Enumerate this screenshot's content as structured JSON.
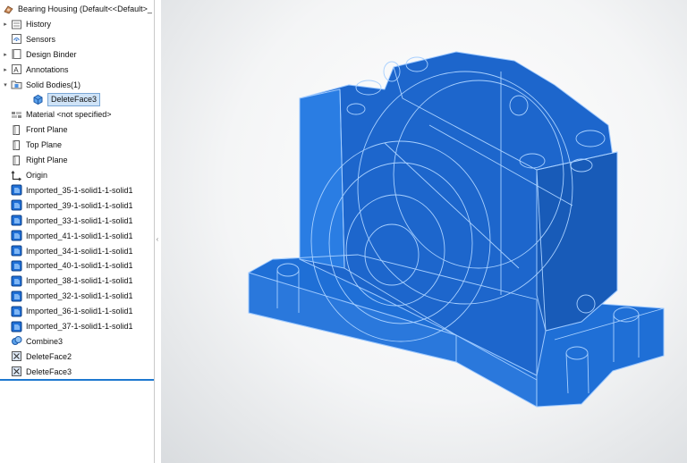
{
  "tree": {
    "root": {
      "label": "Bearing Housing  (Default<<Default>_",
      "icon": "part-icon"
    },
    "items": [
      {
        "label": "History",
        "icon": "history-icon",
        "expand": true
      },
      {
        "label": "Sensors",
        "icon": "sensors-icon",
        "expand": false
      },
      {
        "label": "Design Binder",
        "icon": "design-binder-icon",
        "expand": true
      },
      {
        "label": "Annotations",
        "icon": "annotations-icon",
        "expand": true
      },
      {
        "label": "Solid Bodies(1)",
        "icon": "solid-bodies-folder-icon",
        "expand": "open"
      },
      {
        "label": "DeleteFace3",
        "icon": "solid-body-icon",
        "child": true,
        "selected": true
      },
      {
        "label": "Material <not specified>",
        "icon": "material-icon"
      },
      {
        "label": "Front Plane",
        "icon": "plane-icon"
      },
      {
        "label": "Top Plane",
        "icon": "plane-icon"
      },
      {
        "label": "Right Plane",
        "icon": "plane-icon"
      },
      {
        "label": "Origin",
        "icon": "origin-icon"
      },
      {
        "label": "Imported_35-1-solid1-1-solid1",
        "icon": "imported-body-icon"
      },
      {
        "label": "Imported_39-1-solid1-1-solid1",
        "icon": "imported-body-icon"
      },
      {
        "label": "Imported_33-1-solid1-1-solid1",
        "icon": "imported-body-icon"
      },
      {
        "label": "Imported_41-1-solid1-1-solid1",
        "icon": "imported-body-icon"
      },
      {
        "label": "Imported_34-1-solid1-1-solid1",
        "icon": "imported-body-icon"
      },
      {
        "label": "Imported_40-1-solid1-1-solid1",
        "icon": "imported-body-icon"
      },
      {
        "label": "Imported_38-1-solid1-1-solid1",
        "icon": "imported-body-icon"
      },
      {
        "label": "Imported_32-1-solid1-1-solid1",
        "icon": "imported-body-icon"
      },
      {
        "label": "Imported_36-1-solid1-1-solid1",
        "icon": "imported-body-icon"
      },
      {
        "label": "Imported_37-1-solid1-1-solid1",
        "icon": "imported-body-icon"
      },
      {
        "label": "Combine3",
        "icon": "combine-icon"
      },
      {
        "label": "DeleteFace2",
        "icon": "delete-face-icon"
      },
      {
        "label": "DeleteFace3",
        "icon": "delete-face-icon"
      }
    ]
  },
  "colors": {
    "model_fill": "#1f6fd6",
    "model_edge": "#9cc8ff",
    "selection": "#cfe3f7",
    "accent": "#1e78d0"
  }
}
